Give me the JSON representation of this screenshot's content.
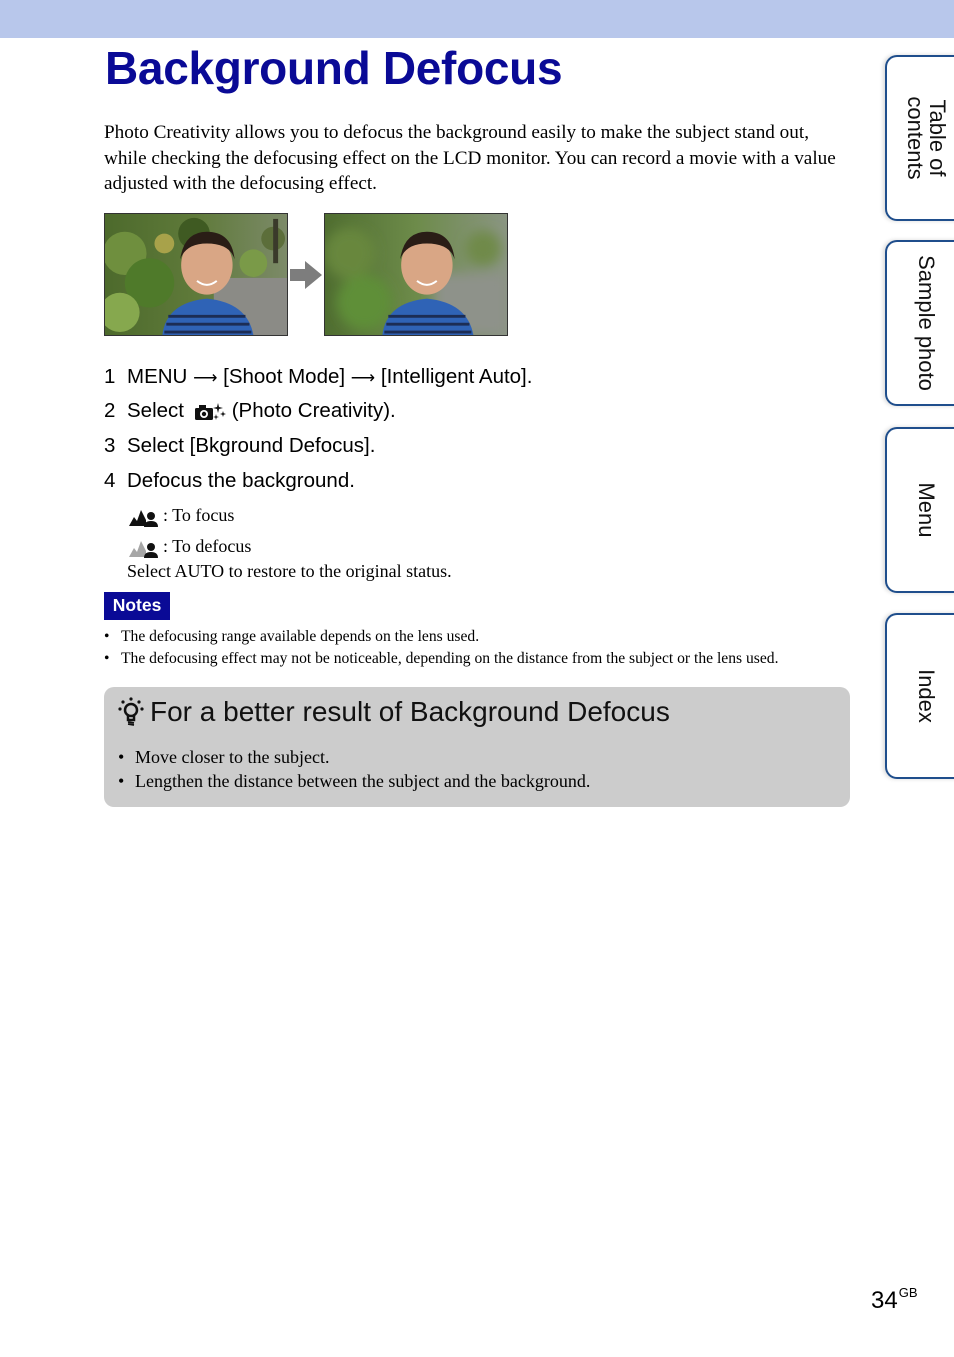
{
  "header": {
    "title": "Background Defocus"
  },
  "intro": "Photo Creativity allows you to defocus the background easily to make the subject stand out, while checking the defocusing effect on the LCD monitor. You can record a movie with a value adjusted with the defocusing effect.",
  "images": {
    "before": "photo of boy with focused background",
    "arrow": "right-arrow-icon",
    "after": "photo of boy with defocused background"
  },
  "steps": [
    {
      "num": "1",
      "parts": [
        "MENU",
        "[Shoot Mode]",
        "[Intelligent Auto]."
      ],
      "separator": "⟶"
    },
    {
      "num": "2",
      "before_icon": "Select",
      "icon": "photo-creativity-icon",
      "after_icon": "(Photo Creativity)."
    },
    {
      "num": "3",
      "text": "Select [Bkground Defocus]."
    },
    {
      "num": "4",
      "text": "Defocus the background."
    }
  ],
  "step4_details": [
    {
      "icon": "focus-icon",
      "text": ": To focus"
    },
    {
      "icon": "defocus-icon",
      "text": ": To defocus"
    },
    {
      "text": "Select AUTO to restore to the original status."
    }
  ],
  "notes": {
    "badge": "Notes",
    "items": [
      "The defocusing range available depends on the lens used.",
      "The defocusing effect may not be noticeable, depending on the distance from the subject or the lens used."
    ]
  },
  "tip": {
    "icon": "lightbulb-hint-icon",
    "title": "For a better result of Background Defocus",
    "items": [
      "Move closer to the subject.",
      "Lengthen the distance between the subject and the background."
    ]
  },
  "side_tabs": [
    {
      "label_line1": "Table of",
      "label_line2": "contents"
    },
    {
      "label": "Sample photo"
    },
    {
      "label": "Menu"
    },
    {
      "label": "Index"
    }
  ],
  "bullet": "•",
  "footer": {
    "page": "34",
    "suffix": "GB"
  },
  "colors": {
    "title_blue": "#0a0a96",
    "band": "#b8c7eb",
    "tip_bg": "#cccccc",
    "tab_border": "#1f4e8c"
  }
}
